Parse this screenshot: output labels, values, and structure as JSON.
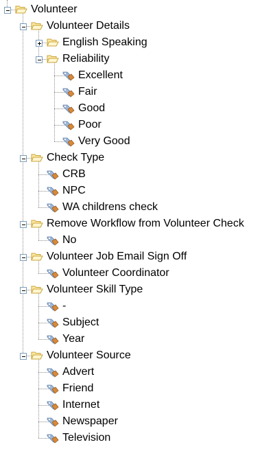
{
  "tree": {
    "label": "Volunteer",
    "expanded": true,
    "children": [
      {
        "label": "Volunteer Details",
        "expanded": true,
        "children": [
          {
            "label": "English Speaking",
            "expanded": false,
            "children": []
          },
          {
            "label": "Reliability",
            "expanded": true,
            "children": [
              {
                "label": "Excellent"
              },
              {
                "label": "Fair"
              },
              {
                "label": "Good"
              },
              {
                "label": "Poor"
              },
              {
                "label": "Very Good"
              }
            ]
          }
        ]
      },
      {
        "label": "Check Type",
        "expanded": true,
        "children": [
          {
            "label": "CRB"
          },
          {
            "label": "NPC"
          },
          {
            "label": "WA childrens check"
          }
        ]
      },
      {
        "label": "Remove Workflow from Volunteer Check",
        "expanded": true,
        "children": [
          {
            "label": "No"
          }
        ]
      },
      {
        "label": "Volunteer Job Email Sign Off",
        "expanded": true,
        "children": [
          {
            "label": "Volunteer Coordinator"
          }
        ]
      },
      {
        "label": "Volunteer Skill Type",
        "expanded": true,
        "children": [
          {
            "label": "-"
          },
          {
            "label": "Subject"
          },
          {
            "label": "Year"
          }
        ]
      },
      {
        "label": "Volunteer Source",
        "expanded": true,
        "children": [
          {
            "label": "Advert"
          },
          {
            "label": "Friend"
          },
          {
            "label": "Internet"
          },
          {
            "label": "Newspaper"
          },
          {
            "label": "Television"
          }
        ]
      }
    ]
  },
  "icons": {
    "folder": "folder-open-icon",
    "leaf": "tag-icon",
    "expand": "expand-plus-icon",
    "collapse": "collapse-minus-icon"
  },
  "colors": {
    "folder_fill": "#fde9a4",
    "folder_edge": "#c9a43c",
    "tree_line": "#8c8c8c",
    "toggle_border": "#7f9db9",
    "leaf_blue": "#9fb7d6",
    "leaf_orange": "#d88a3a"
  }
}
